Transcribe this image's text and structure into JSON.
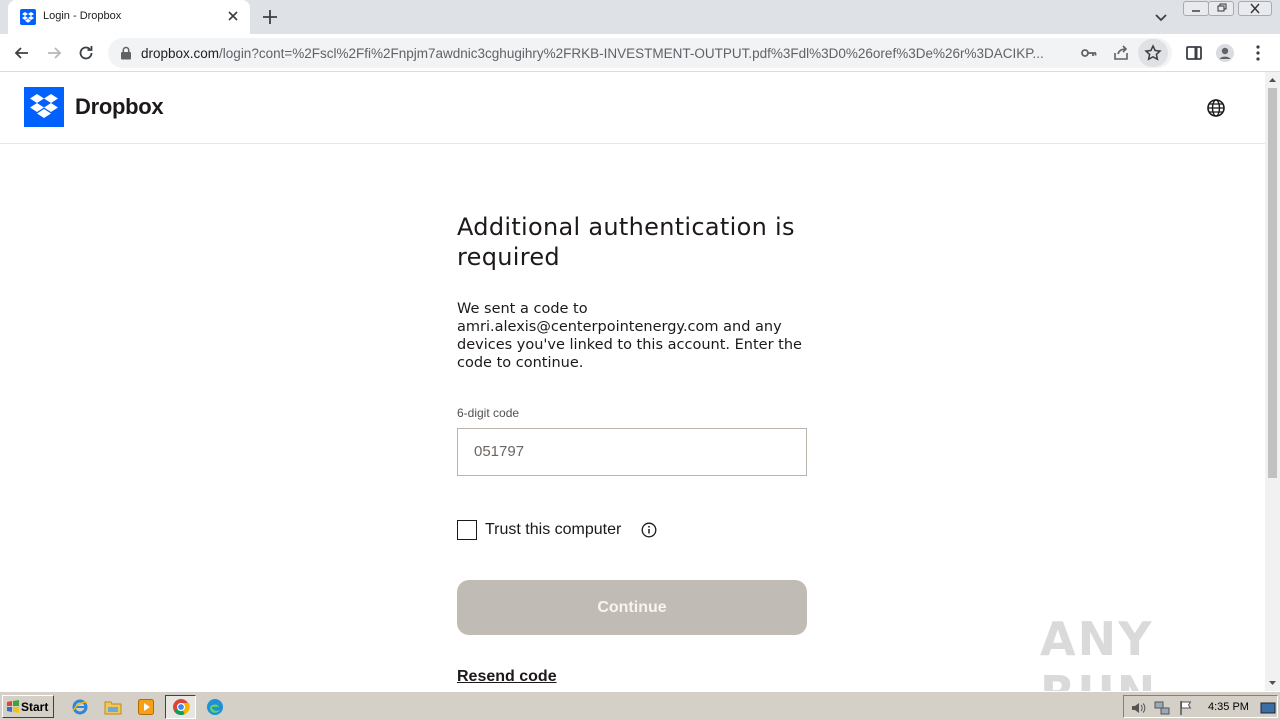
{
  "browser": {
    "tab_title": "Login - Dropbox",
    "url_host": "dropbox.com",
    "url_path": "/login?cont=%2Fscl%2Ffi%2Fnpjm7awdnic3cghugihry%2FRKB-INVESTMENT-OUTPUT.pdf%3Fdl%3D0%26oref%3De%26r%3DACIKP..."
  },
  "header": {
    "brand": "Dropbox"
  },
  "auth": {
    "heading": "Additional authentication is required",
    "description": "We sent a code to amri.alexis@centerpointenergy.com and any devices you've linked to this account. Enter the code to continue.",
    "code_label": "6-digit code",
    "code_value": "051797",
    "trust_label": "Trust this computer",
    "trust_checked": false,
    "continue_label": "Continue",
    "resend_label": "Resend code"
  },
  "watermark": "ANY RUN",
  "taskbar": {
    "start_label": "Start",
    "clock": "4:35 PM"
  },
  "colors": {
    "dropbox_blue": "#0061fe",
    "button_disabled": "#c1bbb6",
    "text": "#1e1919"
  }
}
